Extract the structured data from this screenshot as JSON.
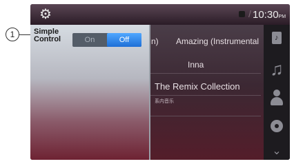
{
  "callout": {
    "number": "1"
  },
  "status_bar": {
    "time": "10:30",
    "ampm": "PM",
    "settings_icon": "gear-icon"
  },
  "panel": {
    "label": "Simple Control",
    "toggle": {
      "on_label": "On",
      "off_label": "Off",
      "selected": "Off"
    }
  },
  "background_list": {
    "row1_fragment": "n)",
    "row1_title": "Amazing (Instrumental",
    "row2": "Inna",
    "row3": "The Remix Collection",
    "row4": "系内音乐"
  },
  "sidebar": {
    "icons": [
      "music-file-icon",
      "music-note-icon",
      "artist-icon",
      "disc-icon",
      "more-chevron-icon"
    ]
  },
  "colors": {
    "accent_blue": "#2f8cf0",
    "panel_top": "#d6dce2",
    "panel_bottom": "#6e2333",
    "sidebar": "#1d1b1f"
  }
}
